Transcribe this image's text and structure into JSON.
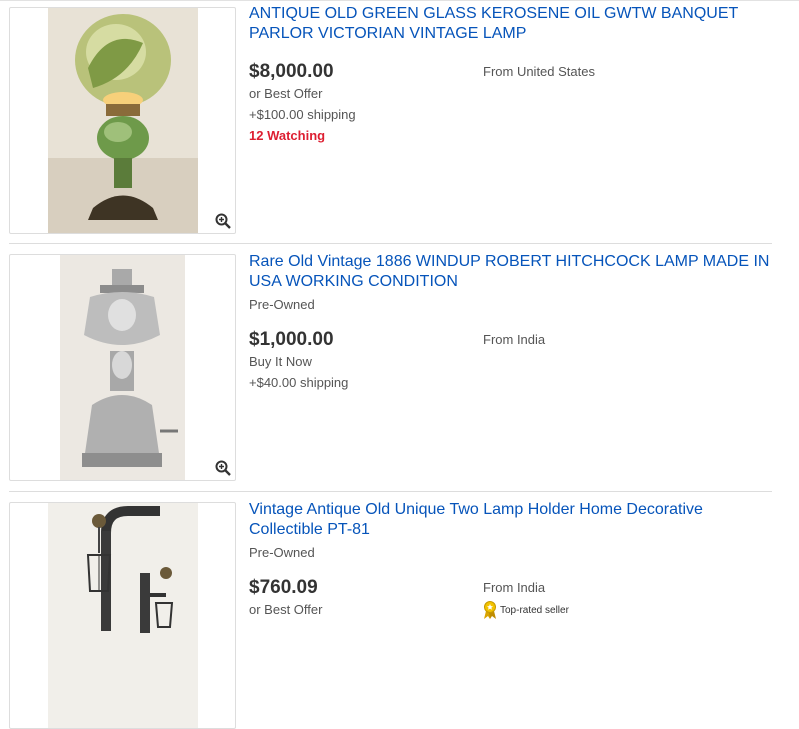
{
  "listings": [
    {
      "title": "ANTIQUE OLD GREEN GLASS KEROSENE OIL GWTW BANQUET PARLOR VICTORIAN VINTAGE LAMP",
      "subtitle": "",
      "price": "$8,000.00",
      "format": "or Best Offer",
      "shipping": "+$100.00 shipping",
      "watching": "12 Watching",
      "location": "From United States"
    },
    {
      "title": "Rare Old Vintage 1886 WINDUP ROBERT HITCHCOCK LAMP MADE IN USA WORKING CONDITION",
      "subtitle": "Pre-Owned",
      "price": "$1,000.00",
      "format": "Buy It Now",
      "shipping": "+$40.00 shipping",
      "location": "From India"
    },
    {
      "title": "Vintage Antique Old Unique Two Lamp Holder Home Decorative Collectible PT-81",
      "subtitle": "Pre-Owned",
      "price": "$760.09",
      "format": "or Best Offer",
      "location": "From India",
      "badge": "Top-rated seller"
    }
  ],
  "icons": {
    "zoom": "zoom-in-icon",
    "badge": "top-rated-seller-icon"
  },
  "colors": {
    "link": "#0654ba",
    "watching": "#dd1e31",
    "price": "#333333"
  }
}
